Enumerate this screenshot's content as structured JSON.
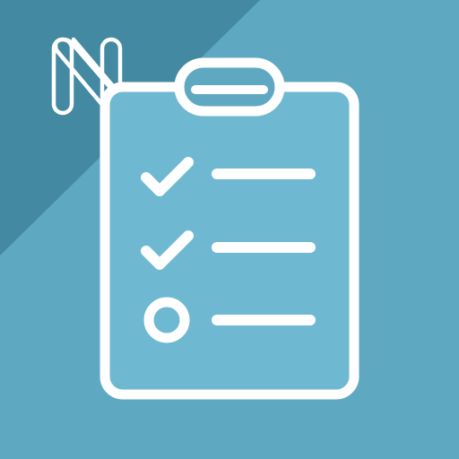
{
  "app_icon": {
    "name": "checklist-app-icon",
    "colors": {
      "background": "#5fa8c2",
      "corner_band": "#4389a2",
      "clipboard_fill": "#6fb8d2",
      "stroke": "#ffffff"
    },
    "logo": "n-monogram-logo",
    "checklist": {
      "items": [
        {
          "state": "checked",
          "icon": "checkmark-icon"
        },
        {
          "state": "checked",
          "icon": "checkmark-icon"
        },
        {
          "state": "unchecked",
          "icon": "empty-circle-icon"
        }
      ]
    }
  }
}
